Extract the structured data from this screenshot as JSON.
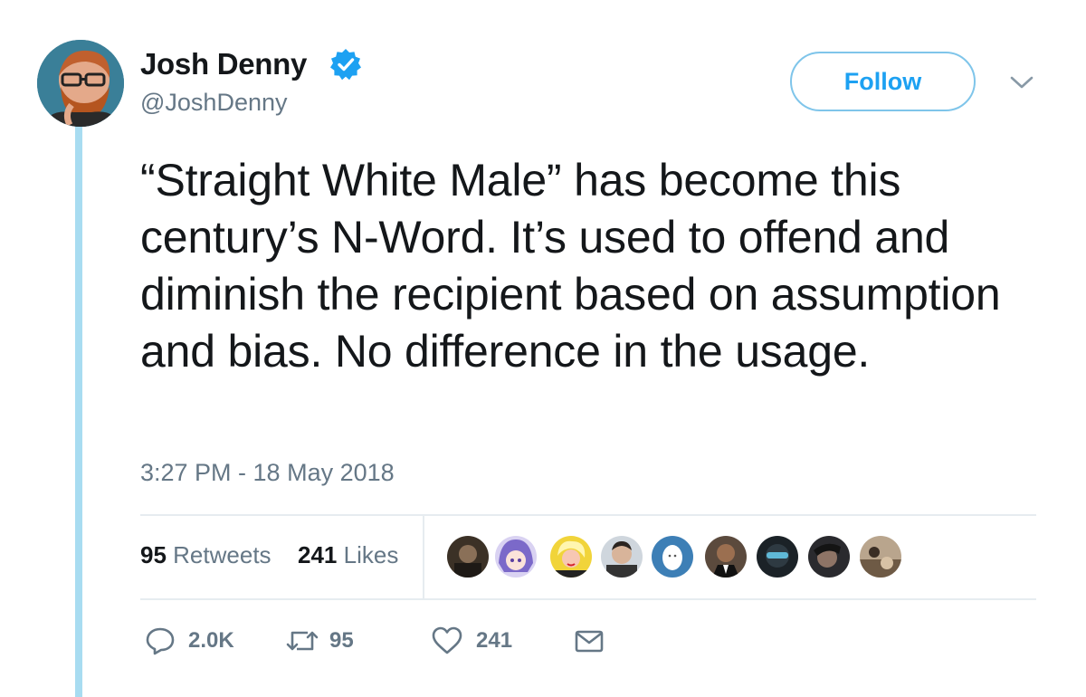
{
  "author": {
    "display_name": "Josh Denny",
    "handle": "@JoshDenny",
    "verified_icon": "verified-badge-icon"
  },
  "follow_button": {
    "label": "Follow"
  },
  "tweet": {
    "text": "“Straight White Male” has become this century’s N-Word. It’s used to offend and diminish the recipient based on assumption and bias. No difference in the usage.",
    "timestamp": "3:27 PM - 18 May 2018"
  },
  "stats": {
    "retweets": {
      "count": "95",
      "label": "Retweets"
    },
    "likes": {
      "count": "241",
      "label": "Likes"
    }
  },
  "actions": {
    "reply": {
      "icon": "reply-icon",
      "count": "2.0K"
    },
    "retweet": {
      "icon": "retweet-icon",
      "count": "95"
    },
    "like": {
      "icon": "heart-icon",
      "count": "241"
    },
    "message": {
      "icon": "envelope-icon"
    }
  },
  "colors": {
    "accent": "#1da1f2",
    "thread_line": "#a8dcf1",
    "secondary_text": "#657786",
    "divider": "#e6ecf0"
  }
}
